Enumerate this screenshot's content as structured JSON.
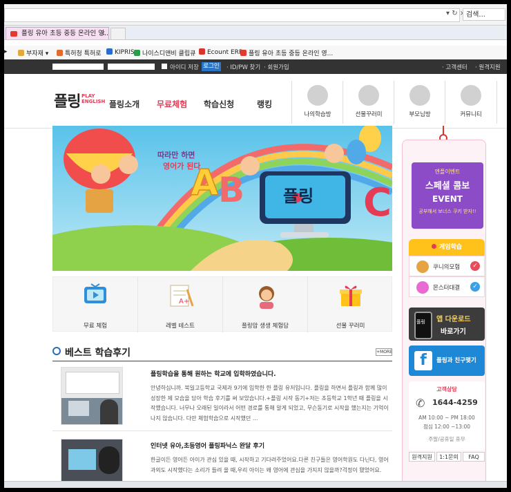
{
  "browser": {
    "search_placeholder": "검색...",
    "tab_title": "플링 유아 초등 중등 온라인 영...",
    "tab_close": "×",
    "favorites": [
      {
        "label": "부자재 ▾",
        "color": "#e0a93a"
      },
      {
        "label": "특허청 특허로",
        "color": "#e06b2b"
      },
      {
        "label": "KIPRIS",
        "color": "#2a6cc9"
      },
      {
        "label": "나이스디앤비 클립큐",
        "color": "#2d9c4a"
      },
      {
        "label": "Ecount ERP",
        "color": "#d9342b"
      },
      {
        "label": "플링 유아 초등 중등 온라인 영...",
        "color": "#e23b2e"
      }
    ]
  },
  "topbar": {
    "remember": "아이디 저장",
    "login": "로그인",
    "find": "· ID/PW 찾기",
    "join": "· 회원가입",
    "service": "· 고객센터",
    "support": "· 원격지원"
  },
  "header": {
    "logo_ko": "플링",
    "logo_en": "PLAY ENGLISH",
    "nav": [
      "플링소개",
      "무료체험",
      "학습신청",
      "랭킹"
    ],
    "nav_active_color": "#e53b55",
    "quick": [
      {
        "label": "나의학습방",
        "icon": "lightbulb-icon"
      },
      {
        "label": "선물꾸러미",
        "icon": "gift-icon"
      },
      {
        "label": "부모님방",
        "icon": "parent-icon"
      },
      {
        "label": "커뮤니티",
        "icon": "monitor-icon"
      }
    ]
  },
  "banner": {
    "line1": "따라만 하면",
    "line2": "영어가 된다",
    "brand": "플링"
  },
  "promo": [
    {
      "label": "무료 체험",
      "icon": "tv-icon"
    },
    {
      "label": "레벨 테스트",
      "icon": "test-paper-icon"
    },
    {
      "label": "플링맘 생생 체험담",
      "icon": "mom-icon"
    },
    {
      "label": "선물 꾸러미",
      "icon": "gift-box-icon"
    }
  ],
  "reviews": {
    "title": "베스트 학습후기",
    "more": "+MORE",
    "items": [
      {
        "title": "플링학습을 통해 원하는 학교에 입학하였습니다.",
        "body": "안녕하십니까. 북일고등학교 국제과 9기에 입학한 한 플링 유저입니다. 플링을 하면서 플링과 함께 많이 성장한 제 모습을 담아 학습 후기를 써 보았습니다.+플링 시작 동기+저는 초등학교 1학년 때 플링을 시작했습니다. 너무나 오래된 일이라서 어떤 경로를 통해 알게 되었고, 무슨동기로 시작을 했는지는 기억이 나지 않습니다. 다만 체험학습으로 시작했던 ..."
      },
      {
        "title": "인터넷 유아,초등영어 플링파닉스 완달 후기",
        "body": "한글이든 영어든 아이가 관심 있을 때, 시작하고 기다려주었어요.다른 친구들은 영어학원도 다닌다, 영어과외도 시작했다는 소리가 들려 올 때,우리 아이는 왜 영어에 관심을 가지지 않을까?걱정이 됐었어요."
      }
    ]
  },
  "sidebar": {
    "event_top": "엔플이벤트",
    "event_main": "스페셜 콤보",
    "event_sub": "EVENT",
    "event_note": "공부해서 보너스 쿠키 받자!!",
    "game_title": "게임학습",
    "games": [
      {
        "label": "쿠니의모험",
        "color": "#e84b5a"
      },
      {
        "label": "몬스터대결",
        "color": "#3aa0e8"
      }
    ],
    "app_line1": "앱 다운로드",
    "app_line2": "바로가기",
    "app_brand": "플링",
    "fb_text": "플링과 친구맺기",
    "cs_title": "고객상담",
    "cs_phone": "1644-4259",
    "cs_hours1": "AM 10:00 ~ PM 18:00",
    "cs_hours2": "점심 12:00 ~13:00",
    "cs_holiday": "주말/공휴일 휴무",
    "cs_tabs": [
      "원격지원",
      "1:1문의",
      "FAQ"
    ]
  }
}
